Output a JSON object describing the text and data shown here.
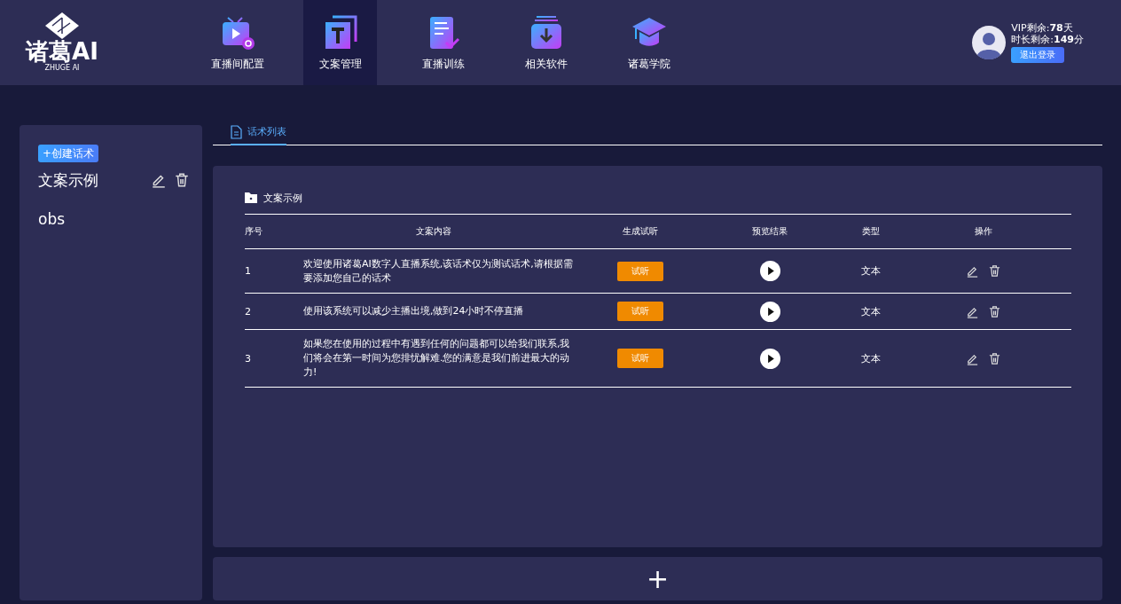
{
  "logo": {
    "title": "诸葛AI",
    "subtitle": "ZHUGE AI"
  },
  "nav": [
    {
      "label": "直播间配置",
      "kind": "tv",
      "selected": false
    },
    {
      "label": "文案管理",
      "kind": "text",
      "selected": true
    },
    {
      "label": "直播训练",
      "kind": "doc",
      "selected": false
    },
    {
      "label": "相关软件",
      "kind": "download",
      "selected": false
    },
    {
      "label": "诸葛学院",
      "kind": "cap",
      "selected": false
    }
  ],
  "user": {
    "vip": "VIP剩余:**78**天",
    "time": "时长剩余:**149**分",
    "logout": "退出登录"
  },
  "sidebar": {
    "create_button": "+创建话术",
    "items": [
      {
        "name": "文案示例",
        "show_actions": true
      },
      {
        "name": "obs",
        "show_actions": false
      }
    ]
  },
  "tabs": [
    {
      "label": "话术列表",
      "selected": true
    }
  ],
  "panel": {
    "title": "文案示例",
    "columns": [
      "序号",
      "文案内容",
      "生成试听",
      "预览结果",
      "类型",
      "操作"
    ],
    "rows": [
      {
        "index": "1",
        "content": "欢迎使用诸葛AI数字人直播系统,该话术仅为测试话术,请根据需要添加您自己的话术",
        "listen": "试听",
        "type": "文本"
      },
      {
        "index": "2",
        "content": "使用该系统可以减少主播出境,做到24小时不停直播",
        "listen": "试听",
        "type": "文本"
      },
      {
        "index": "3",
        "content": "如果您在使用的过程中有遇到任何的问题都可以给我们联系,我们将会在第一时间为您排忧解难.您的满意是我们前进最大的动力!",
        "listen": "试听",
        "type": "文本"
      }
    ]
  },
  "add_button": "+"
}
